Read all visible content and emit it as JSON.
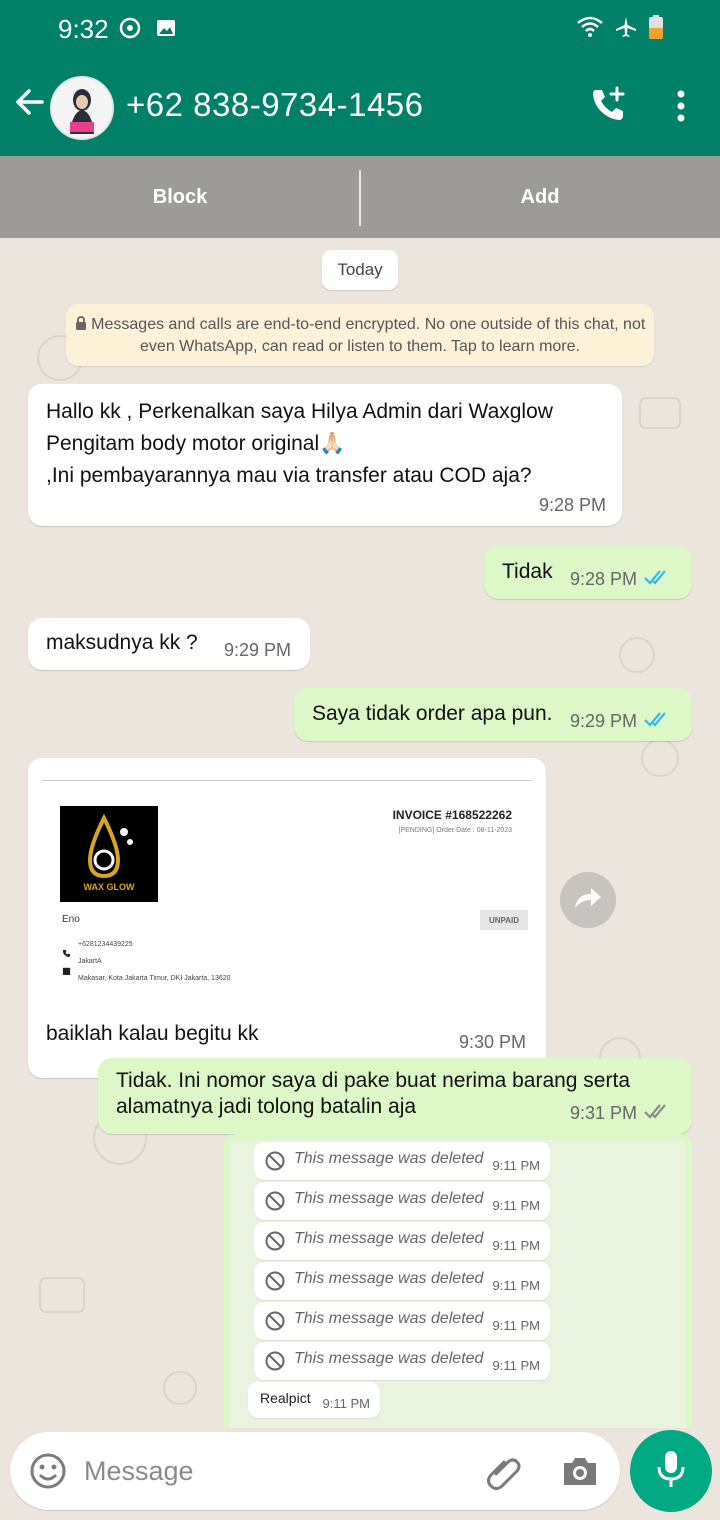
{
  "status_bar": {
    "time": "9:32"
  },
  "header": {
    "contact": "+62 838-9734-1456"
  },
  "action_bar": {
    "block": "Block",
    "add": "Add"
  },
  "chat": {
    "day_chip": "Today",
    "encryption_notice": "Messages and calls are end-to-end encrypted. No one outside of this chat, not even WhatsApp, can read or listen to them. Tap to learn more.",
    "messages": [
      {
        "direction": "in",
        "lines": [
          "Hallo kk , Perkenalkan saya Hilya Admin dari Waxglow",
          "Pengitam body motor original🙏🏻",
          ",Ini pembayarannya mau via transfer atau COD aja?"
        ],
        "time": "9:28 PM"
      },
      {
        "direction": "out",
        "text": "Tidak",
        "time": "9:28 PM",
        "read": true
      },
      {
        "direction": "in",
        "text": "maksudnya kk ?",
        "time": "9:29 PM"
      },
      {
        "direction": "out",
        "text": "Saya tidak order apa pun.",
        "time": "9:29 PM",
        "read": true
      },
      {
        "direction": "in",
        "invoice": {
          "brand_text": "WAX GLOW",
          "title": "INVOICE #168522262",
          "status_line": "[PENDING] Order Date : 08-11-2023",
          "badge": "UNPAID",
          "customer": "Eno",
          "phone": "+6281234439225",
          "address_name": "JakartA",
          "address_line": "Makasar, Kota Jakarta Timur, DKI Jakarta, 13620"
        },
        "caption": "baiklah kalau begitu kk",
        "time": "9:30 PM"
      },
      {
        "direction": "out",
        "lines": [
          "Tidak. Ini nomor saya di pake buat nerima barang serta",
          "alamatnya jadi tolong batalin aja"
        ],
        "time": "9:31 PM",
        "read": false
      }
    ],
    "deleted_screenshot": {
      "items": [
        {
          "text": "This message was deleted",
          "time": "9:11 PM"
        },
        {
          "text": "This message was deleted",
          "time": "9:11 PM"
        },
        {
          "text": "This message was deleted",
          "time": "9:11 PM"
        },
        {
          "text": "This message was deleted",
          "time": "9:11 PM"
        },
        {
          "text": "This message was deleted",
          "time": "9:11 PM"
        },
        {
          "text": "This message was deleted",
          "time": "9:11 PM"
        }
      ],
      "last": {
        "text": "Realpict",
        "time": "9:11 PM"
      }
    }
  },
  "composer": {
    "placeholder": "Message"
  },
  "colors": {
    "header": "#008069",
    "outgoing_bubble": "#dcf8c6",
    "mic_button": "#00a884",
    "read_tick": "#34b7f1"
  }
}
